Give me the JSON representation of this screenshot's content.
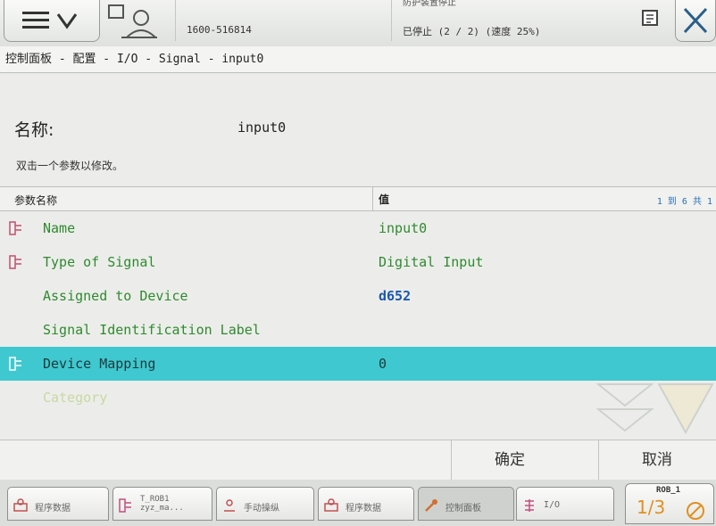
{
  "header": {
    "controller_id": "1600-516814",
    "status_top": "防护装置停止",
    "status_line": "已停止 (2 / 2) (速度 25%)"
  },
  "breadcrumb": "控制面板 - 配置 - I/O - Signal - input0",
  "form": {
    "name_label": "名称:",
    "name_value": "input0",
    "hint": "双击一个参数以修改。"
  },
  "table": {
    "col_param": "参数名称",
    "col_value": "值",
    "count": "1 到 6 共 1",
    "rows": [
      {
        "name": "Name",
        "value": "input0",
        "icon": "signal-param-icon",
        "style": "green"
      },
      {
        "name": "Type of Signal",
        "value": "Digital Input",
        "icon": "signal-param-icon",
        "style": "green"
      },
      {
        "name": "Assigned to Device",
        "value": "d652",
        "icon": "",
        "style": "green-blue"
      },
      {
        "name": "Signal Identification Label",
        "value": "",
        "icon": "",
        "style": "green"
      },
      {
        "name": "Device Mapping",
        "value": "0",
        "icon": "signal-param-icon",
        "style": "selected"
      },
      {
        "name": "Category",
        "value": "",
        "icon": "",
        "style": "faded"
      }
    ]
  },
  "actions": {
    "ok": "确定",
    "cancel": "取消"
  },
  "taskbar": {
    "items": [
      {
        "label": "程序数据",
        "icon": "program-data-icon"
      },
      {
        "label": "T_ROB1\nzyz_ma...",
        "icon": "module-icon"
      },
      {
        "label": "手动操纵",
        "icon": "jog-icon"
      },
      {
        "label": "程序数据",
        "icon": "program-data-icon"
      },
      {
        "label": "控制面板",
        "icon": "control-panel-icon"
      },
      {
        "label": "I/O",
        "icon": "io-icon"
      }
    ],
    "robot": "ROB_1",
    "fraction": "1/3"
  },
  "colors": {
    "selected_row": "#3fc8cf",
    "param_text": "#2f8a2f",
    "link_value": "#1b57b3"
  }
}
